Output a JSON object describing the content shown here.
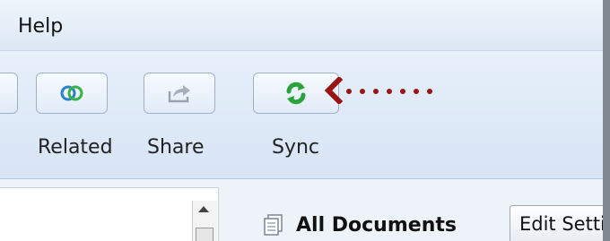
{
  "menubar": {
    "help_label": "Help"
  },
  "toolbar": {
    "buttons": [
      {
        "label": "Related",
        "icon": "related-rings-icon"
      },
      {
        "label": "Share",
        "icon": "share-arrow-icon"
      },
      {
        "label": "Sync",
        "icon": "sync-icon"
      }
    ]
  },
  "panel": {
    "collection_title": "All Documents",
    "edit_settings_label": "Edit Setti"
  },
  "colors": {
    "annotation_arrow": "#9a1414",
    "sync_green": "#2aa33a",
    "related_blue": "#2b7fd1",
    "related_green": "#35b34a"
  }
}
